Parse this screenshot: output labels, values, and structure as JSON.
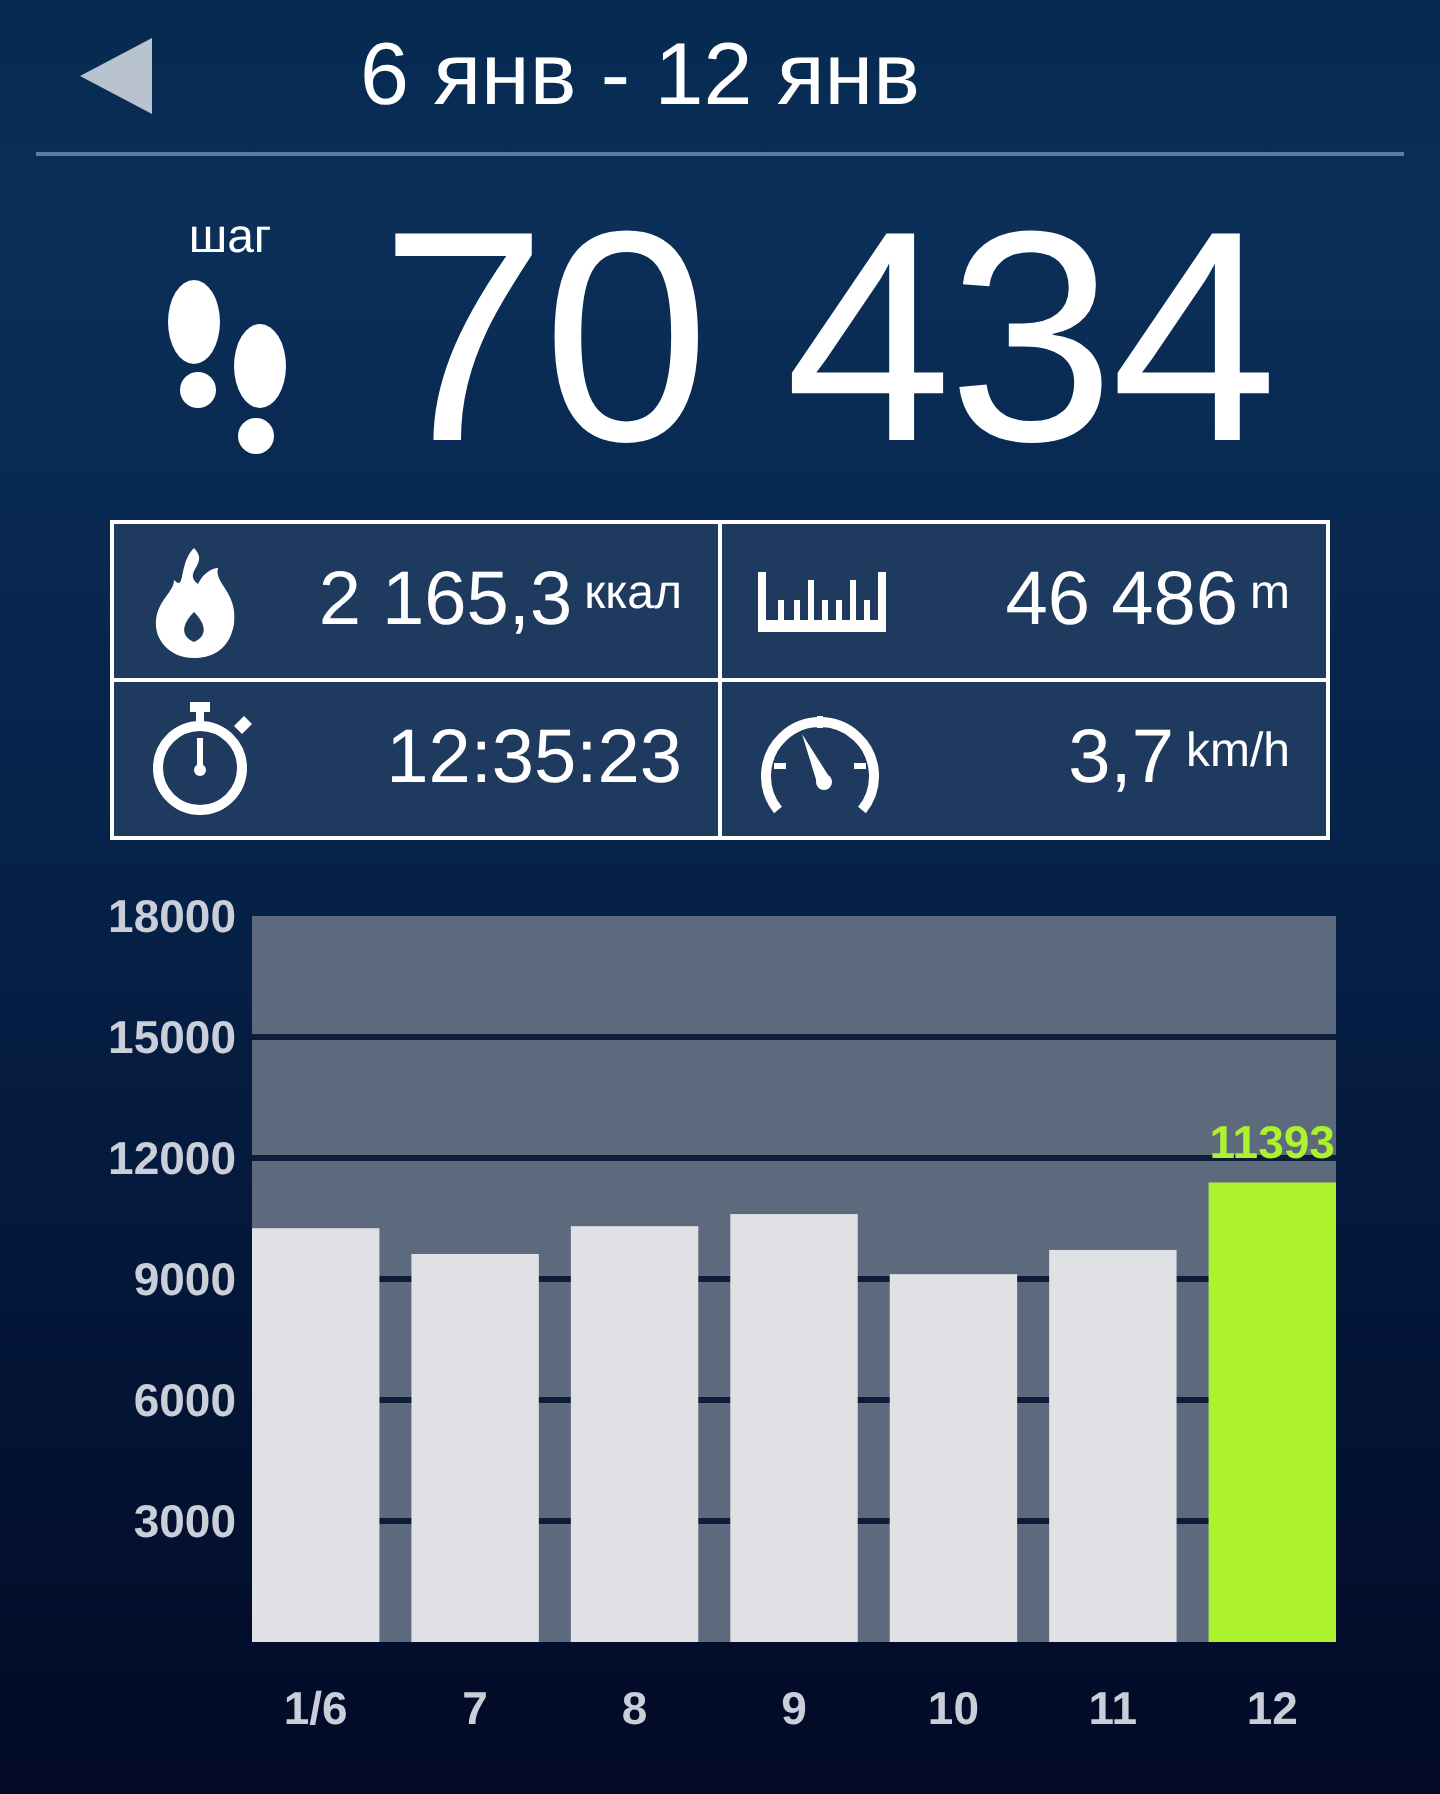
{
  "header": {
    "title": "6 янв - 12 янв"
  },
  "steps": {
    "label": "шаг",
    "value": "70 434"
  },
  "stats": [
    {
      "kind": "fire",
      "value": "2 165,3",
      "unit": "ккал"
    },
    {
      "kind": "ruler",
      "value": "46 486",
      "unit": "m"
    },
    {
      "kind": "stopwatch",
      "value": "12:35:23"
    },
    {
      "kind": "speedometer",
      "value": "3,7",
      "unit": "km/h"
    }
  ],
  "chart_data": {
    "type": "bar",
    "categories": [
      "1/6",
      "7",
      "8",
      "9",
      "10",
      "11",
      "12"
    ],
    "series": [
      {
        "color": "#dfe1e5",
        "values": [
          10260,
          9620,
          10310,
          10610,
          9120,
          9720,
          null
        ]
      },
      {
        "color": "#adf22f",
        "values": [
          null,
          null,
          null,
          null,
          null,
          null,
          11393
        ]
      }
    ],
    "grid": true,
    "ylim": [
      0,
      18000
    ],
    "yticks": [
      3000,
      6000,
      9000,
      12000,
      15000,
      18000
    ],
    "annotations": [
      {
        "x": "12",
        "y": 11393,
        "text": "11393"
      }
    ]
  }
}
